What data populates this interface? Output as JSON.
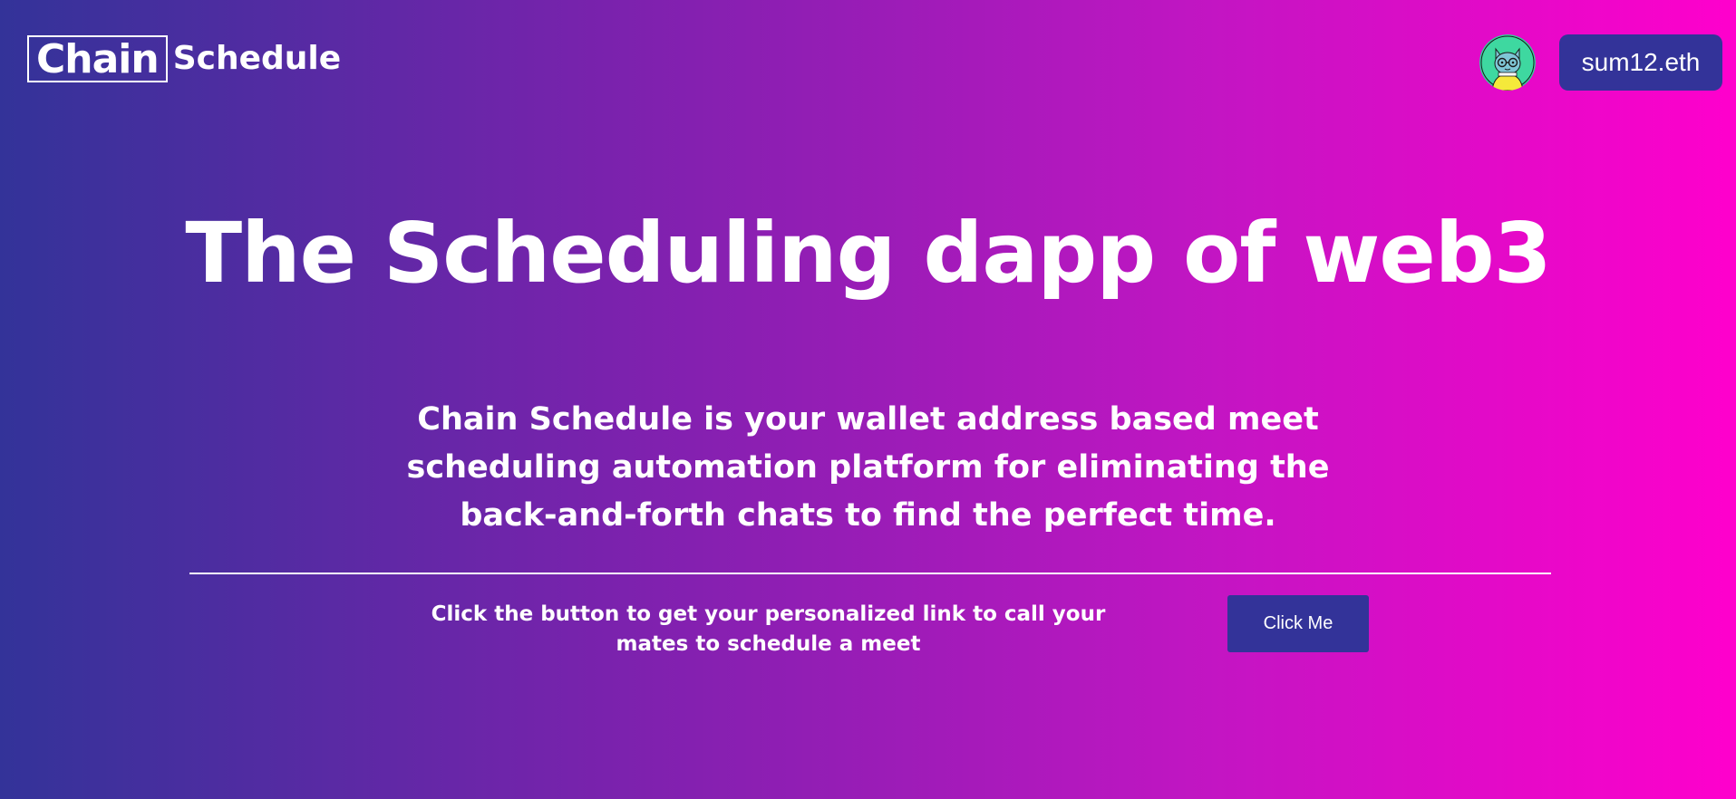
{
  "navbar": {
    "logo_chain": "Chain",
    "logo_schedule": "Schedule",
    "avatar_icon": "nft-cat-avatar-icon",
    "wallet_label": "sum12.eth"
  },
  "hero": {
    "title": "The Scheduling dapp of web3",
    "description": "Chain Schedule is your wallet address based meet scheduling automation platform for eliminating the back-and-forth chats to find the perfect time."
  },
  "cta": {
    "text": "Click the button to get your personalized link to call your mates to schedule a meet",
    "button_label": "Click Me"
  },
  "colors": {
    "gradient_start": "#333399",
    "gradient_end": "#ff00cc",
    "button_bg": "#333399",
    "text": "#ffffff"
  }
}
